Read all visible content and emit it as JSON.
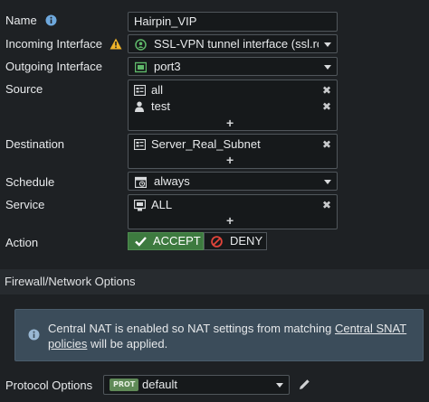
{
  "fields": {
    "name": {
      "label": "Name",
      "value": "Hairpin_VIP"
    },
    "incoming": {
      "label": "Incoming Interface",
      "value": "SSL-VPN tunnel interface (ssl.root)"
    },
    "outgoing": {
      "label": "Outgoing Interface",
      "value": "port3"
    },
    "source": {
      "label": "Source",
      "items": [
        "all",
        "test"
      ]
    },
    "destination": {
      "label": "Destination",
      "items": [
        "Server_Real_Subnet"
      ]
    },
    "schedule": {
      "label": "Schedule",
      "value": "always"
    },
    "service": {
      "label": "Service",
      "items": [
        "ALL"
      ]
    },
    "action": {
      "label": "Action",
      "accept": "ACCEPT",
      "deny": "DENY"
    }
  },
  "section": {
    "title": "Firewall/Network Options"
  },
  "notice": {
    "text_before": "Central NAT is enabled so NAT settings from matching ",
    "link_part1": "Central SNAT",
    "link_part2": "policies",
    "text_after": " will be applied."
  },
  "protocol_options": {
    "label": "Protocol Options",
    "badge": "PROT",
    "value": "default"
  },
  "colors": {
    "accept_bg": "#3d7a3f",
    "deny_icon": "#e0443a",
    "warning_icon": "#f0b429",
    "info_icon": "#6ea8dc"
  }
}
